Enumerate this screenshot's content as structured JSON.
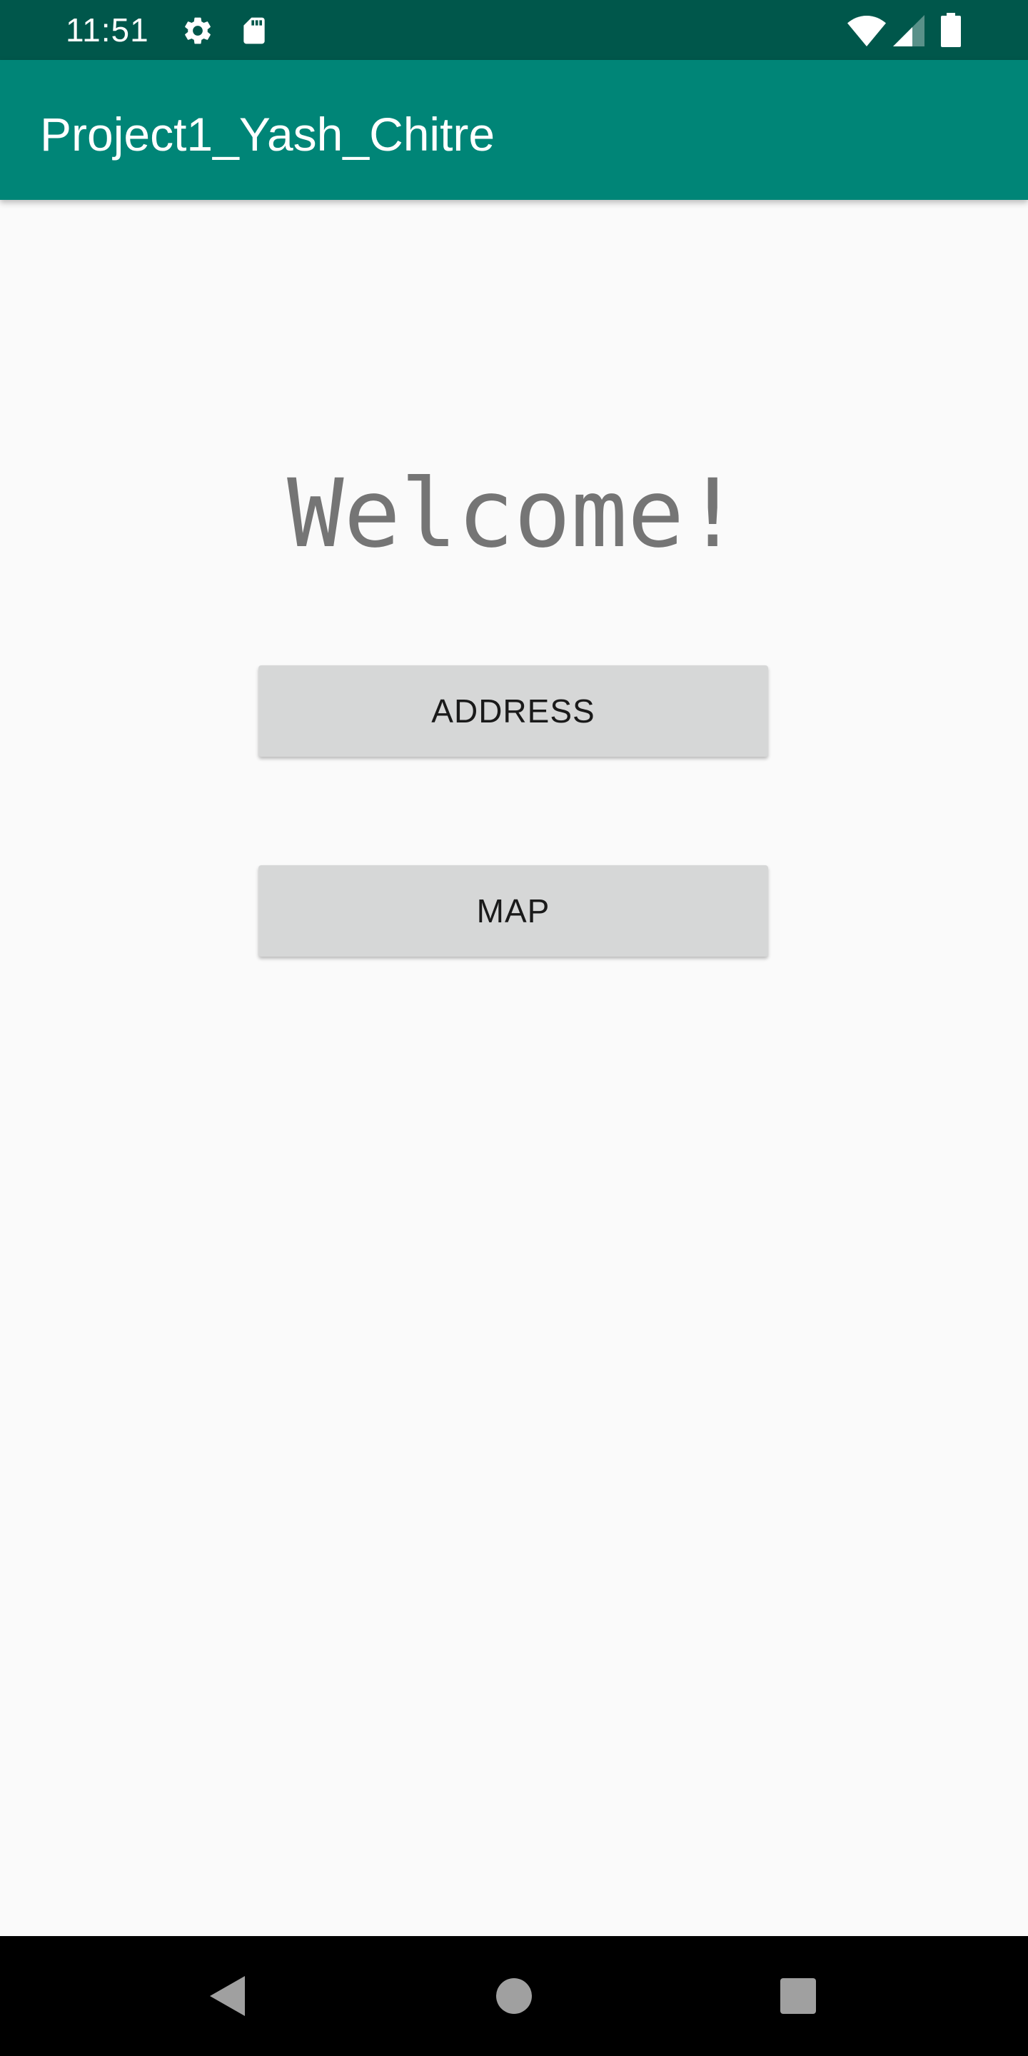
{
  "status_bar": {
    "time": "11:51",
    "icons": [
      "gear-icon",
      "sd-card-icon",
      "wifi-icon",
      "signal-icon",
      "battery-icon"
    ]
  },
  "app_bar": {
    "title": "Project1_Yash_Chitre"
  },
  "main": {
    "welcome_text": "Welcome!",
    "address_button_label": "ADDRESS",
    "map_button_label": "MAP"
  },
  "nav_bar": {
    "icons": [
      "back-icon",
      "home-icon",
      "recents-icon"
    ]
  },
  "colors": {
    "status_bar": "#00574b",
    "app_bar": "#008577",
    "background": "#fafafa",
    "button": "#d6d7d7",
    "welcome_text": "#757575"
  }
}
